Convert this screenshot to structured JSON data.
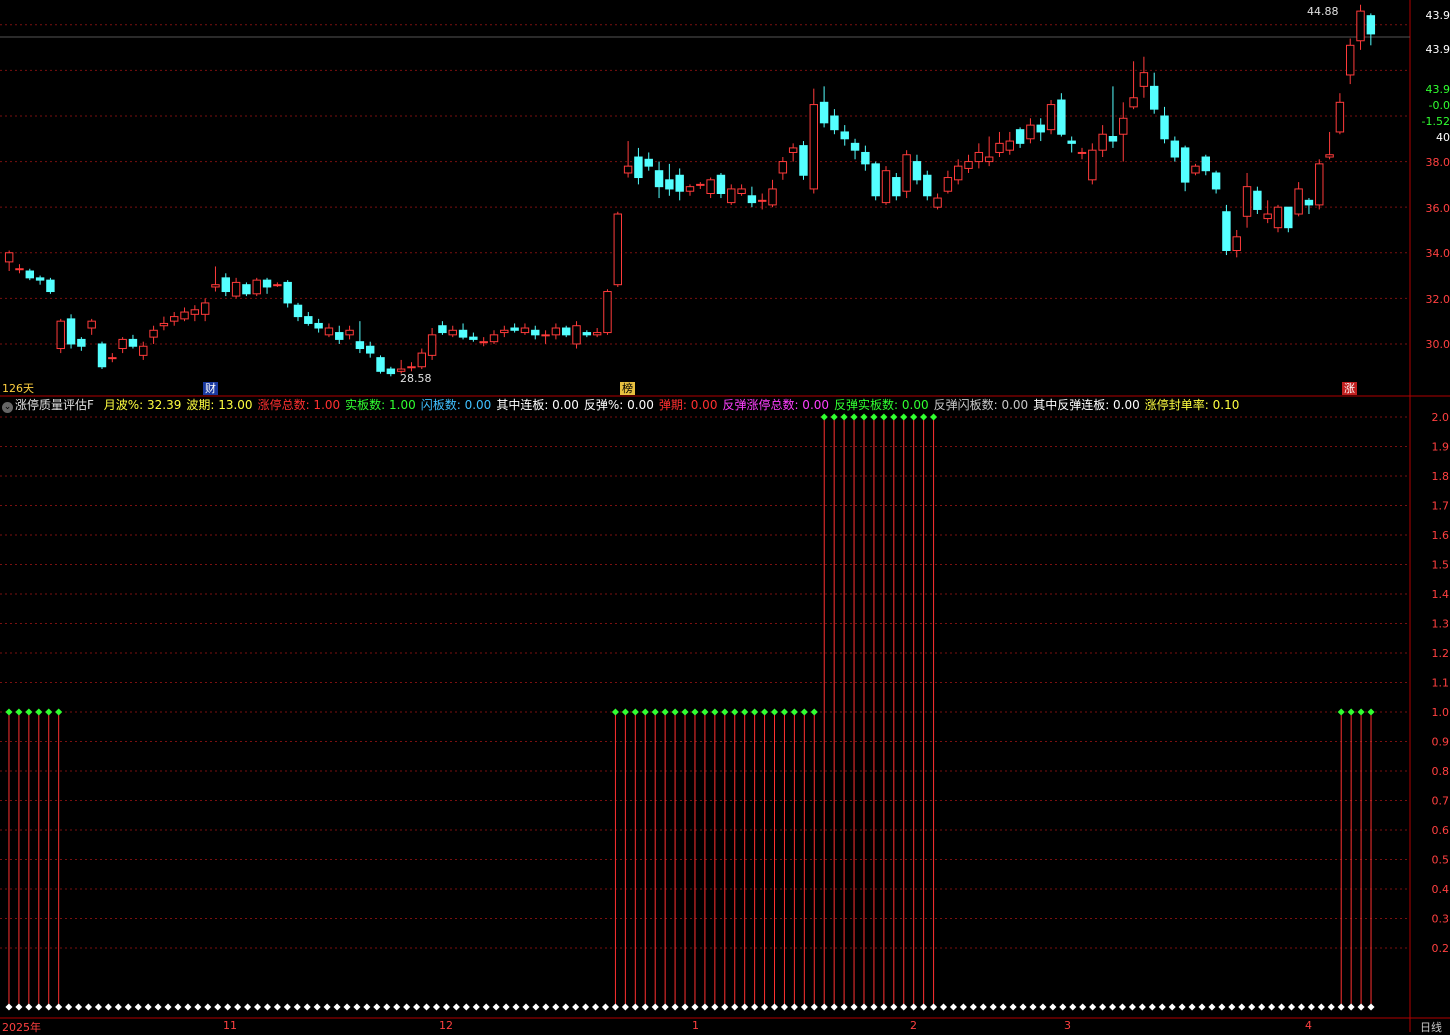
{
  "price_axis": {
    "ticks": [
      "38.0",
      "36.0",
      "34.0",
      "32.0",
      "30.0"
    ],
    "top_labels": [
      "43.9",
      "43.9",
      "43.9",
      "-0.0",
      "-1.52",
      "40"
    ]
  },
  "chart_data": [
    {
      "type": "candlestick",
      "title": "",
      "high_label": "44.88",
      "low_label": "28.58",
      "ylim": [
        28.2,
        45.0
      ],
      "candles": [
        [
          33.6,
          34.0,
          33.2,
          34.1
        ],
        [
          33.3,
          33.3,
          33.1,
          33.5
        ],
        [
          33.2,
          32.9,
          32.8,
          33.3
        ],
        [
          32.9,
          32.8,
          32.6,
          33.0
        ],
        [
          32.8,
          32.3,
          32.2,
          32.9
        ],
        [
          29.8,
          31.0,
          29.6,
          31.1
        ],
        [
          31.1,
          30.0,
          29.8,
          31.3
        ],
        [
          30.2,
          29.9,
          29.7,
          30.3
        ],
        [
          30.7,
          31.0,
          30.4,
          31.1
        ],
        [
          30.0,
          29.0,
          28.9,
          30.1
        ],
        [
          29.4,
          29.4,
          29.2,
          29.6
        ],
        [
          29.8,
          30.2,
          29.6,
          30.3
        ],
        [
          30.2,
          29.9,
          29.8,
          30.4
        ],
        [
          29.5,
          29.9,
          29.3,
          30.1
        ],
        [
          30.3,
          30.6,
          30.0,
          30.8
        ],
        [
          30.8,
          30.9,
          30.6,
          31.2
        ],
        [
          31.0,
          31.2,
          30.8,
          31.4
        ],
        [
          31.1,
          31.4,
          31.0,
          31.6
        ],
        [
          31.3,
          31.5,
          31.0,
          31.7
        ],
        [
          31.3,
          31.8,
          31.0,
          32.0
        ],
        [
          32.5,
          32.6,
          32.3,
          33.4
        ],
        [
          32.9,
          32.3,
          32.1,
          33.1
        ],
        [
          32.1,
          32.7,
          32.0,
          32.9
        ],
        [
          32.6,
          32.2,
          32.1,
          32.7
        ],
        [
          32.2,
          32.8,
          32.1,
          32.9
        ],
        [
          32.8,
          32.5,
          32.2,
          32.9
        ],
        [
          32.6,
          32.6,
          32.5,
          32.7
        ],
        [
          32.7,
          31.8,
          31.6,
          32.8
        ],
        [
          31.7,
          31.2,
          31.0,
          31.8
        ],
        [
          31.2,
          30.9,
          30.8,
          31.4
        ],
        [
          30.9,
          30.7,
          30.5,
          31.1
        ],
        [
          30.4,
          30.7,
          30.3,
          30.9
        ],
        [
          30.5,
          30.2,
          30.0,
          30.8
        ],
        [
          30.4,
          30.6,
          30.2,
          30.8
        ],
        [
          30.1,
          29.8,
          29.6,
          31.0
        ],
        [
          29.9,
          29.6,
          29.4,
          30.1
        ],
        [
          29.4,
          28.8,
          28.7,
          29.5
        ],
        [
          28.9,
          28.7,
          28.58,
          29.0
        ],
        [
          28.8,
          28.9,
          28.7,
          29.3
        ],
        [
          29.0,
          29.0,
          28.8,
          29.2
        ],
        [
          29.0,
          29.6,
          28.9,
          29.8
        ],
        [
          29.5,
          30.4,
          29.3,
          30.7
        ],
        [
          30.8,
          30.5,
          30.4,
          31.0
        ],
        [
          30.4,
          30.6,
          30.3,
          30.8
        ],
        [
          30.6,
          30.3,
          30.2,
          30.9
        ],
        [
          30.3,
          30.2,
          30.1,
          30.5
        ],
        [
          30.1,
          30.1,
          29.9,
          30.3
        ],
        [
          30.1,
          30.4,
          30.0,
          30.6
        ],
        [
          30.5,
          30.6,
          30.3,
          30.8
        ],
        [
          30.7,
          30.6,
          30.5,
          30.9
        ],
        [
          30.5,
          30.7,
          30.4,
          30.9
        ],
        [
          30.6,
          30.4,
          30.2,
          30.8
        ],
        [
          30.4,
          30.4,
          30.0,
          30.6
        ],
        [
          30.4,
          30.7,
          30.2,
          30.9
        ],
        [
          30.7,
          30.4,
          30.3,
          30.8
        ],
        [
          30.0,
          30.8,
          29.8,
          31.0
        ],
        [
          30.5,
          30.4,
          30.3,
          30.6
        ],
        [
          30.4,
          30.5,
          30.3,
          30.7
        ],
        [
          30.5,
          32.3,
          30.4,
          32.4
        ],
        [
          32.6,
          35.7,
          32.5,
          35.8
        ],
        [
          37.5,
          37.8,
          37.3,
          38.9
        ],
        [
          38.2,
          37.3,
          37.0,
          38.6
        ],
        [
          38.1,
          37.8,
          37.6,
          38.4
        ],
        [
          37.6,
          36.9,
          36.4,
          38.0
        ],
        [
          37.2,
          36.8,
          36.5,
          37.9
        ],
        [
          37.4,
          36.7,
          36.3,
          37.7
        ],
        [
          36.7,
          36.9,
          36.5,
          37.0
        ],
        [
          37.0,
          37.0,
          36.8,
          37.1
        ],
        [
          36.6,
          37.2,
          36.4,
          37.3
        ],
        [
          37.4,
          36.6,
          36.4,
          37.5
        ],
        [
          36.2,
          36.8,
          36.1,
          37.0
        ],
        [
          36.6,
          36.8,
          36.5,
          37.0
        ],
        [
          36.5,
          36.2,
          36.0,
          36.9
        ],
        [
          36.3,
          36.3,
          35.9,
          36.6
        ],
        [
          36.1,
          36.8,
          36.0,
          37.2
        ],
        [
          37.5,
          38.0,
          37.2,
          38.2
        ],
        [
          38.4,
          38.6,
          38.0,
          38.8
        ],
        [
          38.7,
          37.4,
          37.2,
          38.9
        ],
        [
          36.8,
          40.5,
          36.6,
          41.2
        ],
        [
          40.6,
          39.7,
          39.5,
          41.3
        ],
        [
          40.0,
          39.4,
          39.2,
          40.3
        ],
        [
          39.3,
          39.0,
          38.7,
          39.6
        ],
        [
          38.8,
          38.5,
          38.1,
          39.0
        ],
        [
          38.4,
          37.9,
          37.6,
          38.7
        ],
        [
          37.9,
          36.5,
          36.3,
          38.0
        ],
        [
          36.2,
          37.6,
          36.1,
          37.8
        ],
        [
          37.3,
          36.5,
          36.3,
          37.5
        ],
        [
          36.7,
          38.3,
          36.4,
          38.5
        ],
        [
          38.0,
          37.2,
          37.0,
          38.3
        ],
        [
          37.4,
          36.5,
          36.3,
          37.6
        ],
        [
          36.0,
          36.4,
          35.9,
          36.6
        ],
        [
          36.7,
          37.3,
          36.6,
          37.6
        ],
        [
          37.2,
          37.8,
          37.0,
          38.1
        ],
        [
          37.7,
          38.0,
          37.5,
          38.3
        ],
        [
          38.0,
          38.4,
          37.7,
          38.8
        ],
        [
          38.0,
          38.2,
          37.8,
          39.1
        ],
        [
          38.4,
          38.8,
          38.2,
          39.3
        ],
        [
          38.5,
          38.9,
          38.3,
          39.3
        ],
        [
          39.4,
          38.8,
          38.6,
          39.5
        ],
        [
          39.0,
          39.6,
          38.8,
          39.9
        ],
        [
          39.6,
          39.3,
          38.9,
          39.9
        ],
        [
          39.4,
          40.5,
          39.2,
          40.7
        ],
        [
          40.7,
          39.2,
          39.1,
          41.0
        ],
        [
          38.9,
          38.8,
          38.4,
          39.1
        ],
        [
          38.4,
          38.4,
          38.1,
          38.6
        ],
        [
          37.2,
          38.5,
          37.0,
          38.8
        ],
        [
          38.5,
          39.2,
          38.2,
          39.6
        ],
        [
          39.1,
          38.9,
          38.6,
          41.3
        ],
        [
          39.2,
          39.9,
          38.0,
          40.6
        ],
        [
          40.4,
          40.8,
          40.3,
          42.4
        ],
        [
          41.3,
          41.9,
          40.8,
          42.6
        ],
        [
          41.3,
          40.3,
          40.1,
          41.9
        ],
        [
          40.0,
          39.0,
          38.8,
          40.4
        ],
        [
          38.9,
          38.2,
          38.0,
          39.1
        ],
        [
          38.6,
          37.1,
          36.7,
          38.7
        ],
        [
          37.5,
          37.8,
          37.4,
          37.9
        ],
        [
          38.2,
          37.6,
          37.4,
          38.3
        ],
        [
          37.5,
          36.8,
          36.6,
          37.6
        ],
        [
          35.8,
          34.1,
          33.9,
          36.1
        ],
        [
          34.1,
          34.7,
          33.8,
          35.0
        ],
        [
          35.6,
          36.9,
          35.1,
          37.5
        ],
        [
          36.7,
          35.9,
          35.7,
          36.9
        ],
        [
          35.5,
          35.7,
          35.3,
          36.3
        ],
        [
          35.1,
          36.0,
          34.9,
          36.1
        ],
        [
          36.0,
          35.1,
          34.9,
          36.0
        ],
        [
          35.7,
          36.8,
          35.6,
          37.1
        ],
        [
          36.3,
          36.1,
          35.7,
          36.4
        ],
        [
          36.1,
          37.9,
          35.9,
          38.1
        ],
        [
          38.2,
          38.3,
          38.1,
          39.3
        ],
        [
          39.3,
          40.6,
          39.2,
          41.0
        ],
        [
          41.8,
          43.1,
          41.4,
          43.4
        ],
        [
          43.3,
          44.6,
          42.9,
          44.88
        ],
        [
          44.4,
          43.6,
          43.1,
          44.5
        ]
      ]
    },
    {
      "type": "bar",
      "title": "涨停质量评估F",
      "ylim": [
        0.0,
        2.0
      ],
      "tick_labels": [
        "2.0",
        "1.9",
        "1.8",
        "1.7",
        "1.6",
        "1.5",
        "1.4",
        "1.3",
        "1.2",
        "1.1",
        "1.0",
        "0.9",
        "0.8",
        "0.7",
        "0.6",
        "0.5",
        "0.4",
        "0.3",
        "0.2"
      ],
      "groups": [
        {
          "from": 0,
          "to": 5,
          "value": 1.0
        },
        {
          "from": 61,
          "to": 81,
          "value": 1.0
        },
        {
          "from": 82,
          "to": 93,
          "value": 2.0
        },
        {
          "from": 134,
          "to": 137,
          "value": 1.0
        }
      ],
      "bar_count": 138
    }
  ],
  "markers": {
    "period": "126天",
    "cai": "财",
    "bang": "榜",
    "zhang": "涨"
  },
  "indicator": {
    "name": "涨停质量评估F",
    "fields": [
      {
        "text": "月波%: 32.39",
        "color": "#ffff40"
      },
      {
        "text": "波期: 13.00",
        "color": "#ffff40"
      },
      {
        "text": "涨停总数: 1.00",
        "color": "#ff3030"
      },
      {
        "text": "实板数: 1.00",
        "color": "#30ff30"
      },
      {
        "text": "闪板数: 0.00",
        "color": "#40c0ff"
      },
      {
        "text": "其中连板: 0.00",
        "color": "#ffffff"
      },
      {
        "text": "反弹%: 0.00",
        "color": "#ffffff"
      },
      {
        "text": "弹期: 0.00",
        "color": "#ff3030"
      },
      {
        "text": "反弹涨停总数: 0.00",
        "color": "#ff40ff"
      },
      {
        "text": "反弹实板数: 0.00",
        "color": "#30ff30"
      },
      {
        "text": "反弹闪板数: 0.00",
        "color": "#c8c8c8"
      },
      {
        "text": "其中反弹连板: 0.00",
        "color": "#ffffff"
      },
      {
        "text": "涨停封单率: 0.10",
        "color": "#ffff40"
      }
    ]
  },
  "dates": [
    "2025年",
    "11",
    "12",
    "1",
    "2",
    "3",
    "4"
  ],
  "period_btn": "日线",
  "colors": {
    "up": "#ff3b3b",
    "down": "#54ffff",
    "grid": "#7a1010",
    "axis": "#b00000"
  }
}
